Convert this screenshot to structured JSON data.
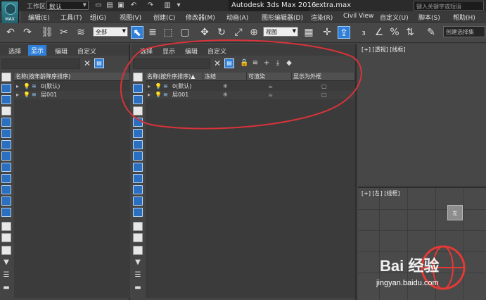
{
  "titlebar": {
    "logo_text": "MAX",
    "workspace_label": "工作区:",
    "workspace_value": "默认",
    "app_title": "Autodesk 3ds Max 2016",
    "file_name": "extra.max",
    "search_placeholder": "键入关键字或短语"
  },
  "menu": [
    "编辑(E)",
    "工具(T)",
    "组(G)",
    "视图(V)",
    "创建(C)",
    "修改器(M)",
    "动画(A)",
    "图形编辑器(D)",
    "渲染(R)",
    "Civil View",
    "自定义(U)",
    "脚本(S)",
    "帮助(H)"
  ],
  "toolbar": {
    "filter_value": "全部",
    "refcoord_value": "视图",
    "selection_set_placeholder": "创建选择集"
  },
  "left_panel": {
    "tabs": [
      "选择",
      "显示",
      "编辑",
      "自定义"
    ],
    "active_tab": 1,
    "columns": [
      "名称(按年龄降序排序)"
    ],
    "rows": [
      {
        "name": "0(默认)"
      },
      {
        "name": "层001"
      }
    ]
  },
  "mid_panel": {
    "tabs": [
      "选择",
      "显示",
      "编辑",
      "自定义"
    ],
    "columns": [
      "名称(按升序排序)",
      "冻结",
      "可渲染",
      "显示为外框"
    ],
    "sort_marker": "▲",
    "rows": [
      {
        "name": "0(默认)"
      },
      {
        "name": "层001"
      }
    ]
  },
  "viewports": {
    "top_label": "[+] [透视] [线框]",
    "left_label": "[+] [左] [线框]",
    "cube_label": "左"
  },
  "watermark": {
    "brand": "Bai 经验",
    "url": "jingyan.baidu.com"
  },
  "colors": {
    "accent": "#2f7fd8",
    "annotation": "#e53935"
  }
}
